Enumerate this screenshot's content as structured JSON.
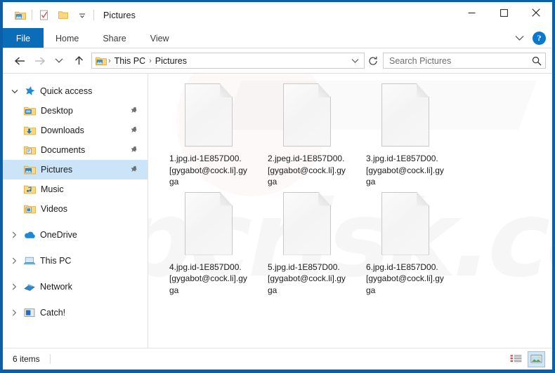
{
  "window": {
    "title": "Pictures",
    "border_color": "#0b5ea8",
    "controls": {
      "minimize": "—",
      "maximize": "☐",
      "close": "✕"
    }
  },
  "quick_access_toolbar": {
    "items": [
      {
        "name": "pictures-folder-icon",
        "label": "Pictures"
      },
      {
        "name": "properties-icon",
        "label": "Properties"
      },
      {
        "name": "new-folder-icon",
        "label": "New folder"
      },
      {
        "name": "customize-dropdown-icon",
        "label": "Customize Quick Access Toolbar"
      }
    ]
  },
  "ribbon": {
    "file_tab": "File",
    "tabs": [
      {
        "label": "Home"
      },
      {
        "label": "Share"
      },
      {
        "label": "View"
      }
    ],
    "expand_label": "⌄",
    "help_label": "?"
  },
  "navigation": {
    "back": "←",
    "forward": "→",
    "recent": "⌄",
    "up": "↑",
    "refresh": "↻",
    "dropdown": "⌄"
  },
  "breadcrumb": {
    "icon": "pictures-folder-icon",
    "separator": "›",
    "parts": [
      "This PC",
      "Pictures"
    ]
  },
  "search": {
    "placeholder": "Search Pictures",
    "icon": "search-icon"
  },
  "sidebar": {
    "groups": [
      {
        "header": {
          "label": "Quick access",
          "icon": "star-icon",
          "expanded": true,
          "chevron": "⌄"
        },
        "items": [
          {
            "label": "Desktop",
            "icon": "desktop-folder-icon",
            "pinned": true,
            "selected": false
          },
          {
            "label": "Downloads",
            "icon": "downloads-folder-icon",
            "pinned": true,
            "selected": false
          },
          {
            "label": "Documents",
            "icon": "documents-folder-icon",
            "pinned": true,
            "selected": false
          },
          {
            "label": "Pictures",
            "icon": "pictures-folder-icon",
            "pinned": true,
            "selected": true
          },
          {
            "label": "Music",
            "icon": "music-folder-icon",
            "pinned": false,
            "selected": false
          },
          {
            "label": "Videos",
            "icon": "videos-folder-icon",
            "pinned": false,
            "selected": false
          }
        ]
      },
      {
        "header": {
          "label": "OneDrive",
          "icon": "onedrive-icon",
          "expanded": false,
          "chevron": "›"
        },
        "items": []
      },
      {
        "header": {
          "label": "This PC",
          "icon": "this-pc-icon",
          "expanded": false,
          "chevron": "›"
        },
        "items": []
      },
      {
        "header": {
          "label": "Network",
          "icon": "network-icon",
          "expanded": false,
          "chevron": "›"
        },
        "items": []
      },
      {
        "header": {
          "label": "Catch!",
          "icon": "catch-icon",
          "expanded": false,
          "chevron": "›"
        },
        "items": []
      }
    ]
  },
  "files": [
    {
      "name": "1.jpg.id-1E857D00.[gygabot@cock.li].gyga",
      "icon": "blank-document-icon"
    },
    {
      "name": "2.jpeg.id-1E857D00.[gygabot@cock.li].gyga",
      "icon": "blank-document-icon"
    },
    {
      "name": "3.jpg.id-1E857D00.[gygabot@cock.li].gyga",
      "icon": "blank-document-icon"
    },
    {
      "name": "4.jpg.id-1E857D00.[gygabot@cock.li].gyga",
      "icon": "blank-document-icon"
    },
    {
      "name": "5.jpg.id-1E857D00.[gygabot@cock.li].gyga",
      "icon": "blank-document-icon"
    },
    {
      "name": "6.jpg.id-1E857D00.[gygabot@cock.li].gyga",
      "icon": "blank-document-icon"
    }
  ],
  "watermark": {
    "text": "pcrisk.com"
  },
  "statusbar": {
    "item_count": "6 items",
    "views": [
      {
        "name": "details-view-button",
        "active": false
      },
      {
        "name": "large-icons-view-button",
        "active": true
      }
    ]
  }
}
